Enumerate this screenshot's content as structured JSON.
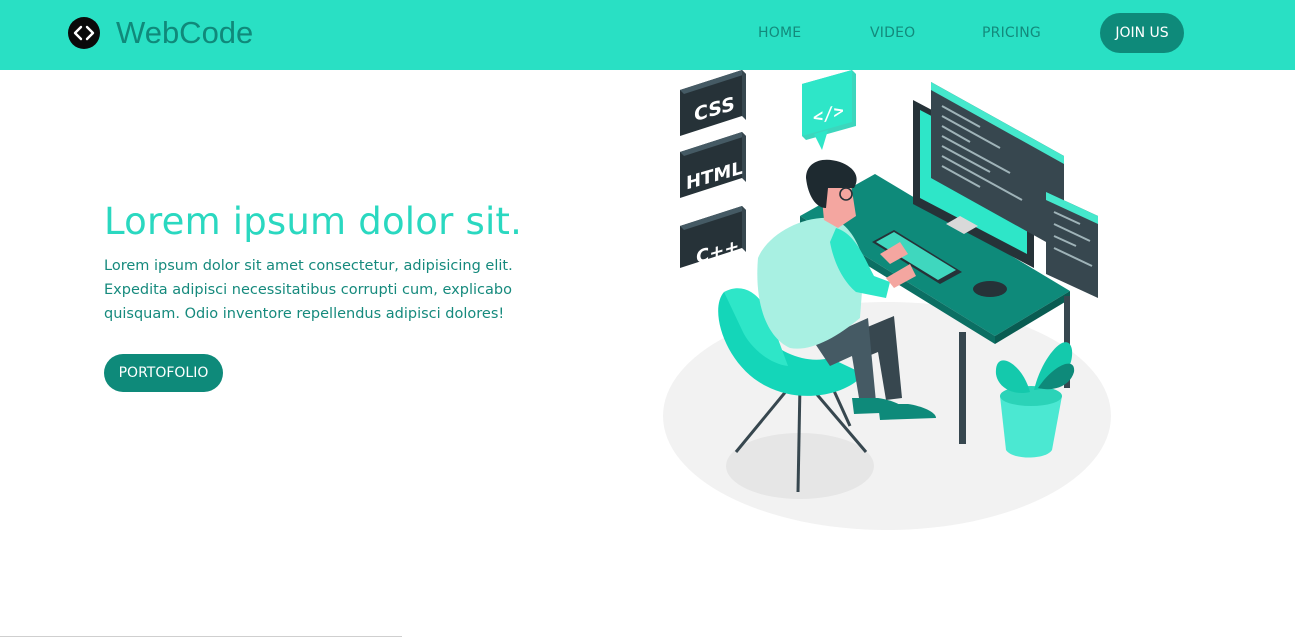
{
  "brand": {
    "name": "WebCode",
    "icon": "code-brackets-icon"
  },
  "nav": {
    "items": [
      {
        "label": "HOME"
      },
      {
        "label": "VIDEO"
      },
      {
        "label": "PRICING"
      }
    ],
    "cta_label": "JOIN US"
  },
  "hero": {
    "title": "Lorem ipsum dolor sit.",
    "text": "Lorem ipsum dolor sit amet consectetur, adipisicing elit. Expedita adipisci necessitatibus corrupti cum, explicabo quisquam. Odio inventore repellendus adipisci dolores!",
    "button_label": "PORTOFOLIO"
  },
  "illustration": {
    "tags": [
      "CSS",
      "HTML",
      "C++"
    ],
    "bubble_symbol": "</>"
  },
  "colors": {
    "navbar": "#29e0c4",
    "accent": "#2ad8c0",
    "button": "#0e8a7a",
    "text": "#168a7d"
  }
}
